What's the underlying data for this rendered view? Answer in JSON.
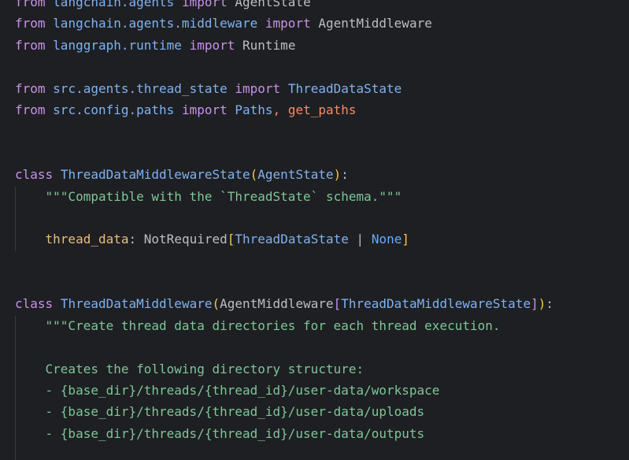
{
  "theme": {
    "background": "#1e1f22",
    "keyword": "#c792ea",
    "module": "#7fb2f0",
    "string": "#7ec699",
    "function": "#ef8f6a",
    "attribute": "#e6c07b",
    "bracket": "#f2c94c"
  },
  "code": {
    "l1": {
      "kw1": "from",
      "mod": "langchain.agents",
      "kw2": "import",
      "name": "AgentState"
    },
    "l2": {
      "kw1": "from",
      "mod": "langchain.agents.middleware",
      "kw2": "import",
      "name": "AgentMiddleware"
    },
    "l3": {
      "kw1": "from",
      "mod": "langgraph.runtime",
      "kw2": "import",
      "name": "Runtime"
    },
    "l5": {
      "kw1": "from",
      "mod": "src.agents.thread_state",
      "kw2": "import",
      "name": "ThreadDataState"
    },
    "l6": {
      "kw1": "from",
      "mod": "src.config.paths",
      "kw2": "import",
      "name1": "Paths",
      "sep": ",",
      "name2": "get_paths"
    },
    "l9": {
      "kw": "class",
      "name": "ThreadDataMiddlewareState",
      "open": "(",
      "base": "AgentState",
      "close": ")",
      "colon": ":"
    },
    "l10": {
      "doc": "\"\"\"Compatible with the `ThreadState` schema.\"\"\""
    },
    "l12": {
      "attr": "thread_data",
      "colon": ":",
      "type": "NotRequired",
      "open": "[",
      "arg": "ThreadDataState",
      "pipe": "|",
      "none": "None",
      "close": "]"
    },
    "l15": {
      "kw": "class",
      "name": "ThreadDataMiddleware",
      "open": "(",
      "base": "AgentMiddleware",
      "open2": "[",
      "generic": "ThreadDataMiddlewareState",
      "close2": "]",
      "close": ")",
      "colon": ":"
    },
    "l16": {
      "doc": "\"\"\"Create thread data directories for each thread execution."
    },
    "l18": {
      "doc": "Creates the following directory structure:"
    },
    "l19": {
      "doc": "- {base_dir}/threads/{thread_id}/user-data/workspace"
    },
    "l20": {
      "doc": "- {base_dir}/threads/{thread_id}/user-data/uploads"
    },
    "l21": {
      "doc": "- {base_dir}/threads/{thread_id}/user-data/outputs"
    }
  }
}
